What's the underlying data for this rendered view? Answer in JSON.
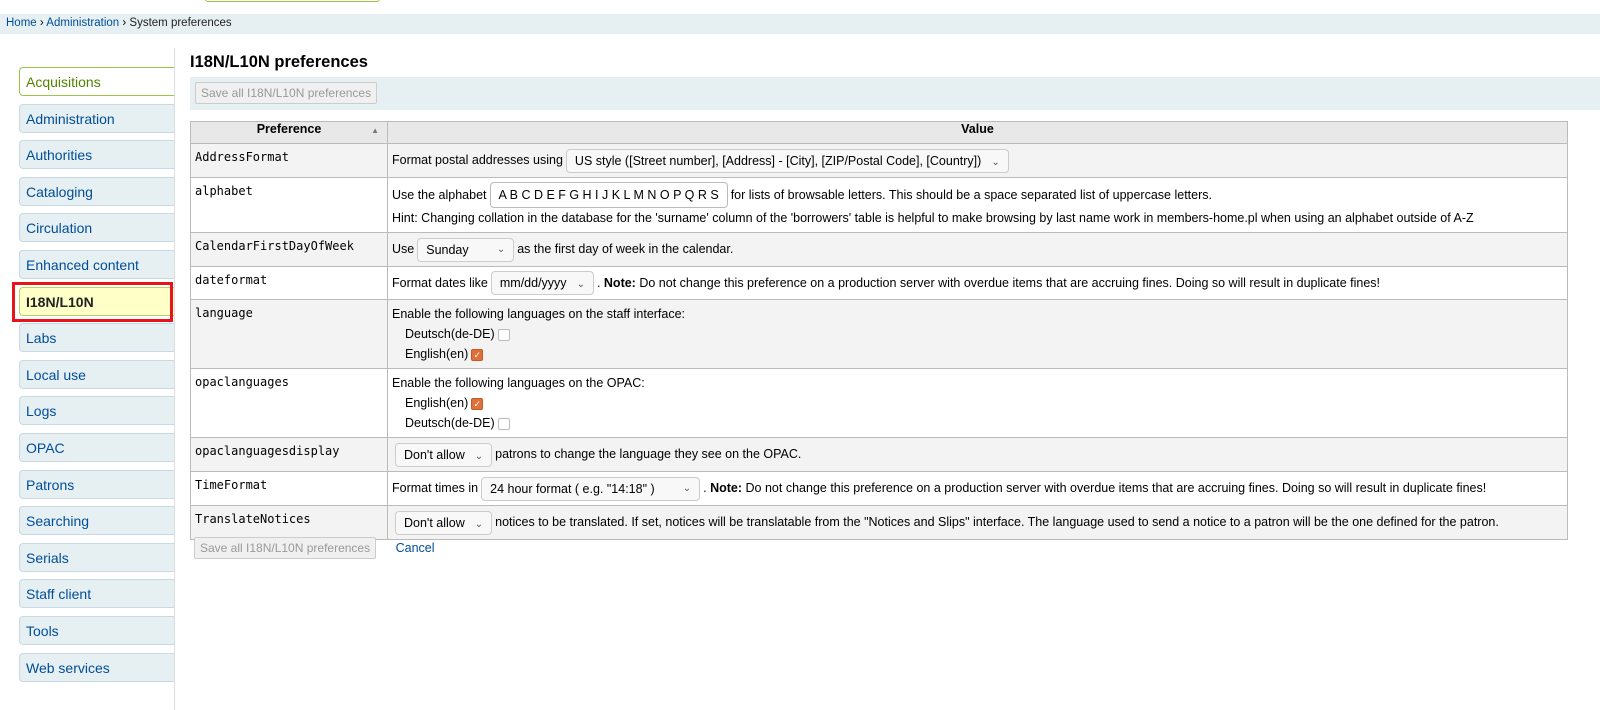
{
  "breadcrumb": {
    "home": "Home",
    "admin": "Administration",
    "current": "System preferences",
    "sep": "›"
  },
  "sidebar": {
    "items": [
      "Acquisitions",
      "Administration",
      "Authorities",
      "Cataloging",
      "Circulation",
      "Enhanced content",
      "I18N/L10N",
      "Labs",
      "Local use",
      "Logs",
      "OPAC",
      "Patrons",
      "Searching",
      "Serials",
      "Staff client",
      "Tools",
      "Web services"
    ],
    "current": "I18N/L10N"
  },
  "page": {
    "title": "I18N/L10N preferences",
    "save_label": "Save all I18N/L10N preferences",
    "cancel_label": "Cancel"
  },
  "table": {
    "headers": {
      "pref": "Preference",
      "value": "Value"
    },
    "rows": {
      "address": {
        "name": "AddressFormat",
        "pre": "Format postal addresses using",
        "select": "US style ([Street number], [Address] - [City], [ZIP/Postal Code], [Country])"
      },
      "alphabet": {
        "name": "alphabet",
        "pre": "Use the alphabet",
        "value": "A B C D E F G H I J K L M N O P Q R S",
        "post": "for lists of browsable letters. This should be a space separated list of uppercase letters.",
        "hint": "Hint: Changing collation in the database for the 'surname' column of the 'borrowers' table is helpful to make browsing by last name work in members-home.pl when using an alphabet outside of A-Z"
      },
      "calendar": {
        "name": "CalendarFirstDayOfWeek",
        "pre": "Use",
        "select": "Sunday",
        "post": "as the first day of week in the calendar."
      },
      "dateformat": {
        "name": "dateformat",
        "pre": "Format dates like",
        "select": "mm/dd/yyyy",
        "note_label": "Note:",
        "note": "Do not change this preference on a production server with overdue items that are accruing fines. Doing so will result in duplicate fines!"
      },
      "language": {
        "name": "language",
        "text": "Enable the following languages on the staff interface:",
        "opt1": "Deutsch(de-DE)",
        "opt1_checked": false,
        "opt2": "English(en)",
        "opt2_checked": true
      },
      "opaclanguages": {
        "name": "opaclanguages",
        "text": "Enable the following languages on the OPAC:",
        "opt1": "English(en)",
        "opt1_checked": true,
        "opt2": "Deutsch(de-DE)",
        "opt2_checked": false
      },
      "opacdisplay": {
        "name": "opaclanguagesdisplay",
        "select": "Don't allow",
        "post": "patrons to change the language they see on the OPAC."
      },
      "timeformat": {
        "name": "TimeFormat",
        "pre": "Format times in",
        "select": "24 hour format ( e.g. \"14:18\" )",
        "note_label": "Note:",
        "note": "Do not change this preference on a production server with overdue items that are accruing fines. Doing so will result in duplicate fines!"
      },
      "translate": {
        "name": "TranslateNotices",
        "select": "Don't allow",
        "post": "notices to be translated. If set, notices will be translatable from the \"Notices and Slips\" interface. The language used to send a notice to a patron will be the one defined for the patron."
      }
    }
  }
}
